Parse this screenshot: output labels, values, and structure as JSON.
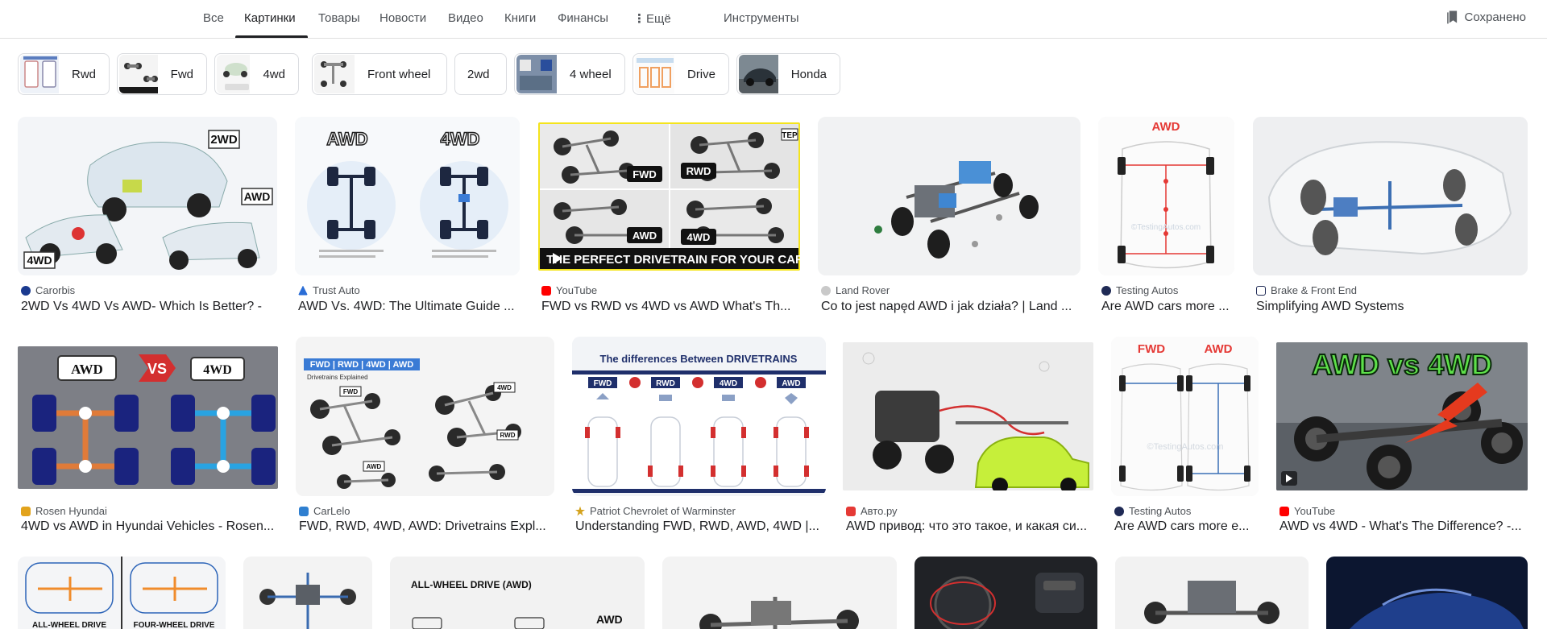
{
  "nav": {
    "tabs": [
      "Все",
      "Картинки",
      "Товары",
      "Новости",
      "Видео",
      "Книги",
      "Финансы",
      "Ещё"
    ],
    "tools": "Инструменты",
    "saved": "Сохранено"
  },
  "chips": [
    "Rwd",
    "Fwd",
    "4wd",
    "Front wheel",
    "2wd",
    "4 wheel",
    "Drive",
    "Honda"
  ],
  "results": [
    {
      "source": "Carorbis",
      "title": "2WD Vs 4WD Vs AWD- Which Is Better? -",
      "img_labels": [
        "2WD",
        "AWD",
        "4WD"
      ]
    },
    {
      "source": "Trust Auto",
      "title": "AWD Vs. 4WD: The Ultimate Guide ...",
      "img_labels": [
        "AWD",
        "4WD"
      ]
    },
    {
      "source": "YouTube",
      "title": "FWD vs RWD vs 4WD vs AWD What's Th...",
      "img_labels": [
        "FWD",
        "RWD",
        "AWD",
        "4WD",
        "THE PERFECT DRIVETRAIN FOR YOUR CAR",
        "TEP"
      ]
    },
    {
      "source": "Land Rover",
      "title": "Co to jest napęd AWD i jak działa? | Land ...",
      "img_labels": []
    },
    {
      "source": "Testing Autos",
      "title": "Are AWD cars more ...",
      "img_labels": [
        "AWD",
        "©TestingAutos.com"
      ]
    },
    {
      "source": "Brake & Front End",
      "title": "Simplifying AWD Systems",
      "img_labels": []
    },
    {
      "source": "Rosen Hyundai",
      "title": "4WD vs AWD in Hyundai Vehicles - Rosen...",
      "img_labels": [
        "AWD",
        "VS",
        "4WD"
      ]
    },
    {
      "source": "CarLelo",
      "title": "FWD, RWD, 4WD, AWD: Drivetrains Expl...",
      "img_labels": [
        "FWD | RWD | 4WD | AWD",
        "Drivetrains Explained",
        "FWD",
        "4WD",
        "RWD",
        "AWD"
      ]
    },
    {
      "source": "Patriot Chevrolet of Warminster",
      "title": "Understanding FWD, RWD, AWD, 4WD |...",
      "img_labels": [
        "The differences Between DRIVETRAINS",
        "FWD",
        "RWD",
        "4WD",
        "AWD",
        "vs"
      ]
    },
    {
      "source": "Авто.ру",
      "title": "AWD привод: что это такое, и какая си...",
      "img_labels": []
    },
    {
      "source": "Testing Autos",
      "title": "Are AWD cars more e...",
      "img_labels": [
        "FWD",
        "AWD",
        "©TestingAutos.com"
      ]
    },
    {
      "source": "YouTube",
      "title": "AWD vs 4WD - What's The Difference? -...",
      "img_labels": [
        "AWD vs 4WD"
      ]
    },
    {
      "img_labels": [
        "ALL-WHEEL DRIVE",
        "FOUR-WHEEL DRIVE"
      ]
    },
    {
      "img_labels": []
    },
    {
      "img_labels": [
        "ALL-WHEEL DRIVE (AWD)",
        "AWD"
      ]
    },
    {
      "img_labels": []
    },
    {
      "img_labels": []
    },
    {
      "img_labels": []
    },
    {
      "img_labels": []
    }
  ],
  "colors": {
    "accent_blue": "#1a73e8",
    "youtube_red": "#ff0000",
    "awd_red": "#e53935",
    "awd_green": "#6dd24a"
  }
}
